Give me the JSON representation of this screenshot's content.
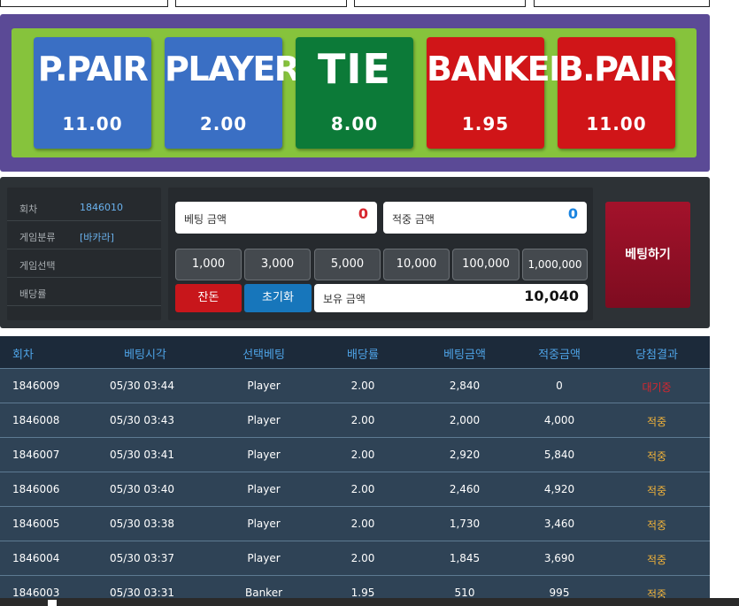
{
  "bet_options": [
    {
      "name": "P.PAIR",
      "odd": "11.00",
      "color": "#3a6fc4"
    },
    {
      "name": "PLAYER",
      "odd": "2.00",
      "color": "#3a6fc4"
    },
    {
      "name": "TIE",
      "odd": "8.00",
      "color": "#0c7a38"
    },
    {
      "name": "BANKER",
      "odd": "1.95",
      "color": "#d01518"
    },
    {
      "name": "B.PAIR",
      "odd": "11.00",
      "color": "#d01518"
    }
  ],
  "info": {
    "rows": [
      {
        "label": "회차",
        "value": "1846010"
      },
      {
        "label": "게임분류",
        "value": "[바카라]"
      },
      {
        "label": "게임선택",
        "value": ""
      },
      {
        "label": "배당률",
        "value": ""
      }
    ]
  },
  "form": {
    "bet_amount_label": "베팅 금액",
    "bet_amount_value": "0",
    "win_amount_label": "적중 금액",
    "win_amount_value": "0",
    "chips": [
      "1,000",
      "3,000",
      "5,000",
      "10,000",
      "100,000",
      "1,000,000"
    ],
    "small_change_label": "잔돈",
    "reset_label": "초기화",
    "balance_label": "보유 금액",
    "balance_value": "10,040"
  },
  "submit_label": "베팅하기",
  "history": {
    "headers": [
      "회차",
      "베팅시각",
      "선택베팅",
      "배당률",
      "베팅금액",
      "적중금액",
      "당첨결과"
    ],
    "rows": [
      [
        "1846009",
        "05/30 03:44",
        "Player",
        "2.00",
        "2,840",
        "0",
        "대기중"
      ],
      [
        "1846008",
        "05/30 03:43",
        "Player",
        "2.00",
        "2,000",
        "4,000",
        "적중"
      ],
      [
        "1846007",
        "05/30 03:41",
        "Player",
        "2.00",
        "2,920",
        "5,840",
        "적중"
      ],
      [
        "1846006",
        "05/30 03:40",
        "Player",
        "2.00",
        "2,460",
        "4,920",
        "적중"
      ],
      [
        "1846005",
        "05/30 03:38",
        "Player",
        "2.00",
        "1,730",
        "3,460",
        "적중"
      ],
      [
        "1846004",
        "05/30 03:37",
        "Player",
        "2.00",
        "1,845",
        "3,690",
        "적중"
      ],
      [
        "1846003",
        "05/30 03:31",
        "Banker",
        "1.95",
        "510",
        "995",
        "적중"
      ]
    ]
  },
  "colors": {
    "accent_red": "#d8262e",
    "accent_blue": "#1a84e0",
    "win_gold": "#f0b23a"
  }
}
